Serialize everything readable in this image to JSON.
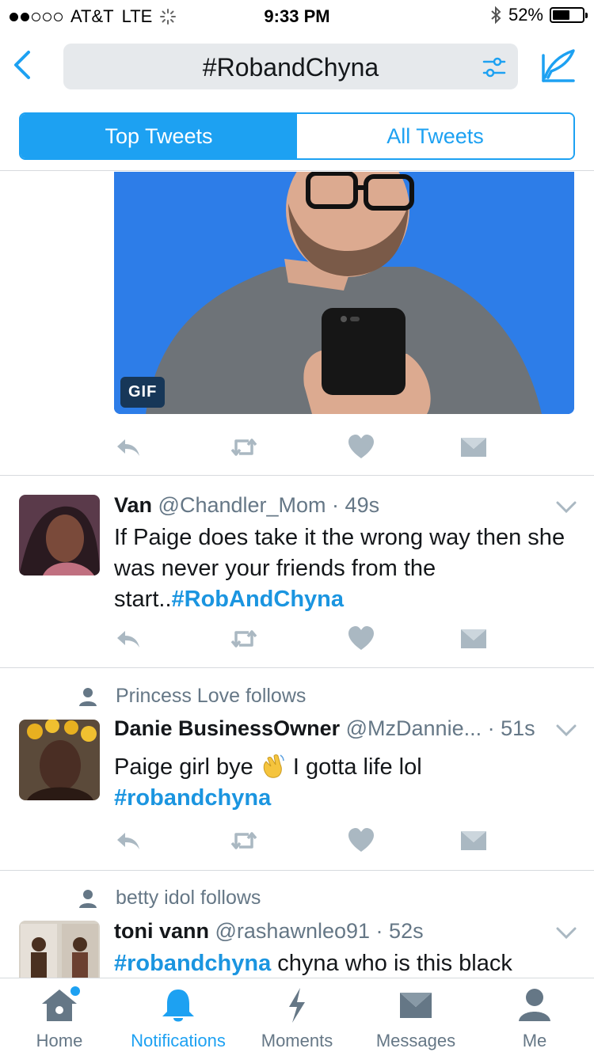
{
  "status_bar": {
    "carrier": "AT&T",
    "network": "LTE",
    "time": "9:33 PM",
    "battery": "52%",
    "signal_bars_filled": 2,
    "signal_bars_total": 5
  },
  "header": {
    "search_query": "#RobandChyna",
    "tabs": [
      {
        "label": "Top Tweets",
        "active": true
      },
      {
        "label": "All Tweets",
        "active": false
      }
    ]
  },
  "feed": {
    "gif_badge": "GIF",
    "tweets": [
      {
        "name": "Van",
        "handle": "@Chandler_Mom",
        "time": "49s",
        "text": "If Paige does take it the wrong way then she was never your friends from the start..",
        "hashtag": "#RobAndChyna"
      },
      {
        "social_context": "Princess Love follows",
        "name": "Danie BusinessOwner",
        "handle": "@MzDannie...",
        "time": "51s",
        "text_before_emoji": "Paige girl bye",
        "text_after_emoji": "I gotta life lol",
        "hashtag": "#robandchyna"
      },
      {
        "social_context": "betty idol follows",
        "name": "toni vann",
        "handle": "@rashawnleo91",
        "time": "52s",
        "hashtag": "#robandchyna",
        "text": "chyna who is this black"
      }
    ]
  },
  "tabbar": {
    "items": [
      {
        "label": "Home",
        "icon": "home-icon"
      },
      {
        "label": "Notifications",
        "icon": "bell-icon"
      },
      {
        "label": "Moments",
        "icon": "lightning-icon"
      },
      {
        "label": "Messages",
        "icon": "envelope-icon"
      },
      {
        "label": "Me",
        "icon": "person-icon"
      }
    ]
  },
  "colors": {
    "accent": "#1da1f2",
    "hashtag": "#1b95e0",
    "muted": "#657786",
    "icon_gray": "#aab8c2",
    "gif_background": "#2d7de8"
  }
}
